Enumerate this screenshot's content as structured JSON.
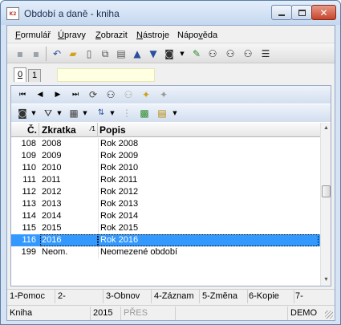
{
  "window": {
    "title": "Období a daně - kniha",
    "app_icon_text": "K2"
  },
  "menu": [
    {
      "pre": "",
      "key": "F",
      "post": "ormulář"
    },
    {
      "pre": "",
      "key": "Ú",
      "post": "pravy"
    },
    {
      "pre": "",
      "key": "Z",
      "post": "obrazit"
    },
    {
      "pre": "",
      "key": "N",
      "post": "ástroje"
    },
    {
      "pre": "Nápo",
      "key": "v",
      "post": "ěda"
    }
  ],
  "tabs": [
    {
      "label": "0",
      "active": true
    },
    {
      "label": "1",
      "active": false
    }
  ],
  "grid": {
    "columns": {
      "num": "Č.",
      "zkratka": "Zkratka",
      "popis": "Popis",
      "sort_indicator": "1"
    },
    "rows": [
      {
        "num": "108",
        "zkratka": "2008",
        "popis": "Rok 2008"
      },
      {
        "num": "109",
        "zkratka": "2009",
        "popis": "Rok 2009"
      },
      {
        "num": "110",
        "zkratka": "2010",
        "popis": "Rok 2010"
      },
      {
        "num": "111",
        "zkratka": "2011",
        "popis": "Rok 2011"
      },
      {
        "num": "112",
        "zkratka": "2012",
        "popis": "Rok 2012"
      },
      {
        "num": "113",
        "zkratka": "2013",
        "popis": "Rok 2013"
      },
      {
        "num": "114",
        "zkratka": "2014",
        "popis": "Rok 2014"
      },
      {
        "num": "115",
        "zkratka": "2015",
        "popis": "Rok 2015"
      },
      {
        "num": "116",
        "zkratka": "2016",
        "popis": "Rok 2016",
        "selected": true
      },
      {
        "num": "199",
        "zkratka": "Neom.",
        "popis": "Neomezené období"
      }
    ]
  },
  "function_keys": [
    "1-Pomoc",
    "2-",
    "3-Obnov",
    "4-Záznam",
    "5-Změna",
    "6-Kopie",
    "7-"
  ],
  "status": {
    "module": "Kniha",
    "year": "2015",
    "mode": "PŘES",
    "db": "DEMO"
  },
  "colors": {
    "selection": "#3399ff",
    "window_frame": "#d6e3f3",
    "quick_filter": "#ffffe1"
  }
}
